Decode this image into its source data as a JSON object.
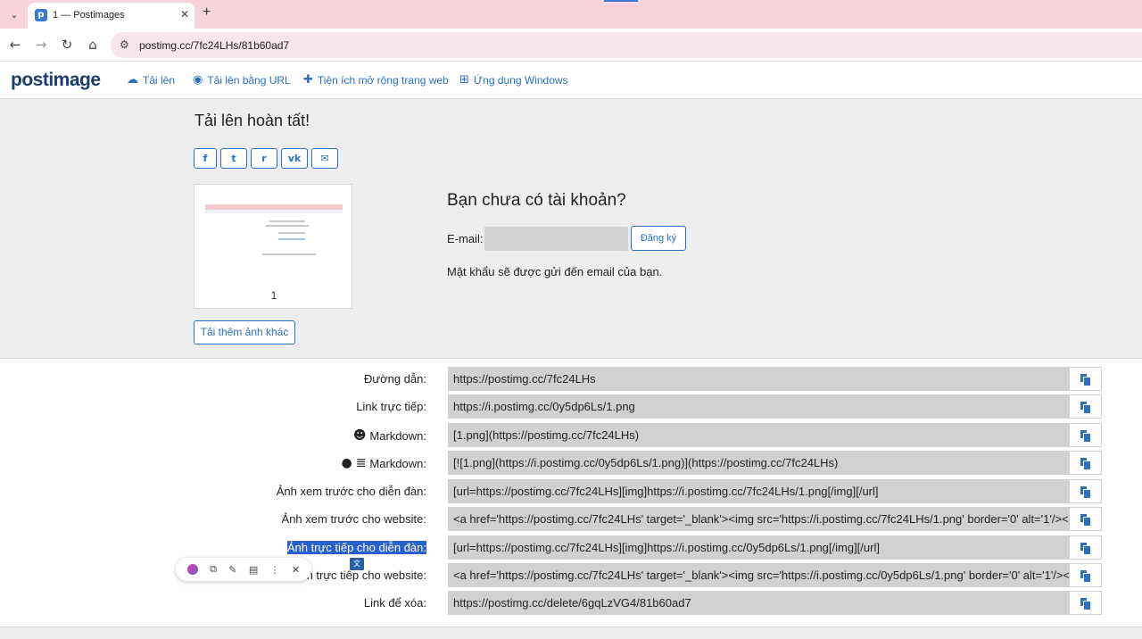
{
  "browser": {
    "tab_title": "1 — Postimages",
    "url": "postimg.cc/7fc24LHs/81b60ad7"
  },
  "header": {
    "logo": "postimage",
    "nav": [
      {
        "label": "Tải lên",
        "icon": "cloud-upload-icon"
      },
      {
        "label": "Tải lên bằng URL",
        "icon": "globe-icon"
      },
      {
        "label": "Tiện ích mở rộng trang web",
        "icon": "puzzle-icon"
      },
      {
        "label": "Ứng dụng Windows",
        "icon": "windows-icon"
      }
    ]
  },
  "upload": {
    "title": "Tải lên hoàn tất!",
    "share": [
      "f",
      "t",
      "r",
      "vk",
      "✉"
    ],
    "thumb_caption": "1",
    "more_button": "Tải thêm ảnh khác"
  },
  "account": {
    "title": "Bạn chưa có tài khoản?",
    "email_label": "E-mail:",
    "email_value": "",
    "signup_button": "Đăng ký",
    "password_note": "Mật khẩu sẽ được gửi đến email của bạn."
  },
  "links": [
    {
      "label": "Đường dẫn:",
      "value": "https://postimg.cc/7fc24LHs"
    },
    {
      "label": "Link trực tiếp:",
      "value": "https://i.postimg.cc/0y5dp6Ls/1.png"
    },
    {
      "label": "Markdown:",
      "value": "[1.png](https://postimg.cc/7fc24LHs)"
    },
    {
      "label": "Markdown:",
      "value": "[![1.png](https://i.postimg.cc/0y5dp6Ls/1.png)](https://postimg.cc/7fc24LHs)"
    },
    {
      "label": "Ảnh xem trước cho diễn đàn:",
      "value": "[url=https://postimg.cc/7fc24LHs][img]https://i.postimg.cc/7fc24LHs/1.png[/img][/url]"
    },
    {
      "label": "Ảnh xem trước cho website:",
      "value": "<a href='https://postimg.cc/7fc24LHs' target='_blank'><img src='https://i.postimg.cc/7fc24LHs/1.png' border='0' alt='1'/></a>"
    },
    {
      "label": "Ảnh trực tiếp cho diễn đàn:",
      "value": "[url=https://postimg.cc/7fc24LHs][img]https://i.postimg.cc/0y5dp6Ls/1.png[/img][/url]"
    },
    {
      "label": "h trực tiếp cho website:",
      "value": "<a href='https://postimg.cc/7fc24LHs' target='_blank'><img src='https://i.postimg.cc/0y5dp6Ls/1.png' border='0' alt='1'/></a>"
    },
    {
      "label": "Link để xóa:",
      "value": "https://postimg.cc/delete/6gqLzVG4/81b60ad7"
    }
  ]
}
